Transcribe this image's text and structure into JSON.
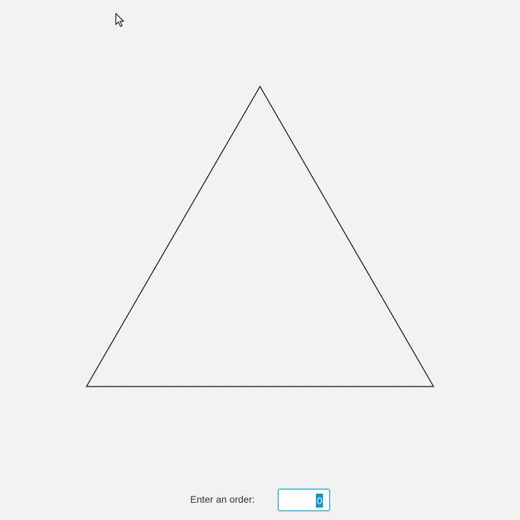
{
  "figure": {
    "shape": "triangle",
    "stroke_color": "#000000"
  },
  "cursor": {
    "icon": "arrow-cursor-icon"
  },
  "order": {
    "label": "Enter an order:",
    "value": "0",
    "accent_color": "#2a9fd6",
    "selection_color": "#0096c9"
  }
}
